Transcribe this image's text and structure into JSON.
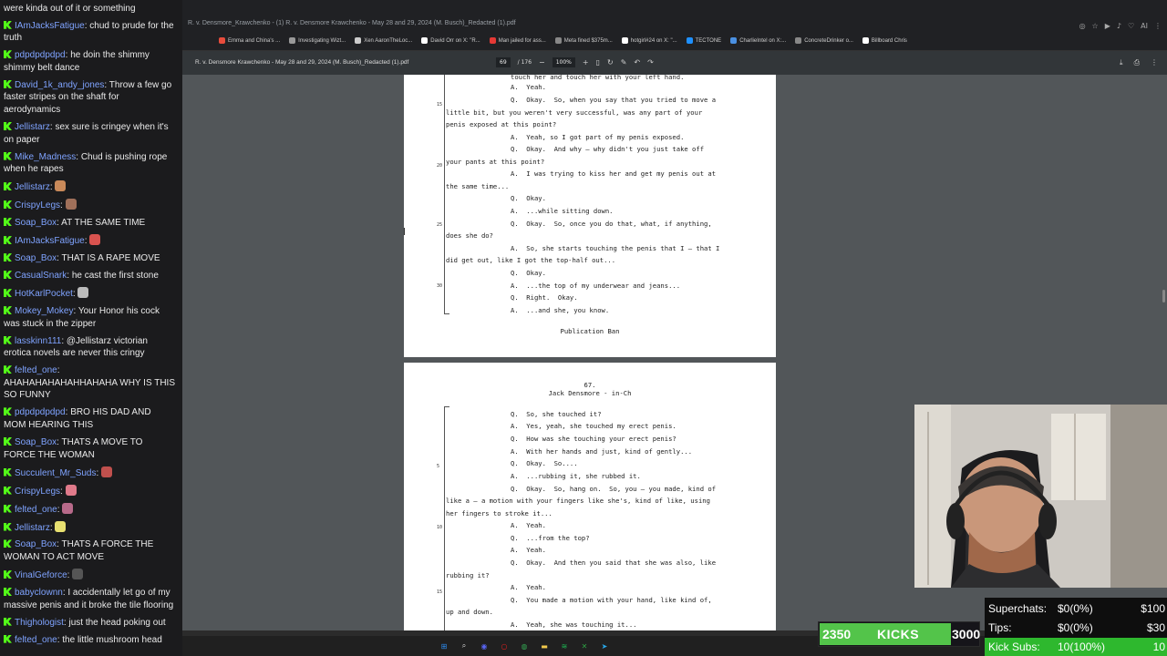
{
  "browser": {
    "url": "R. v. Densmore_Krawchenko - (1) R. v. Densmore Krawchenko - May 28 and 29, 2024 (M. Busch)_Redacted (1).pdf",
    "bookmarks": [
      "Emma and China's ...",
      "Investigating Wizt...",
      "Xen AaronTheLoc...",
      "David Orr on X: \"R...",
      "Man jailed for ass...",
      "Meta fined $375m...",
      "hotgirl#24 on X: \"...",
      "TECTONE",
      "CharlieIntel on X:...",
      "ConcreteDrinker o...",
      "Billboard Chris"
    ],
    "bookmark_colors": [
      "#e74c3c",
      "#999999",
      "#cccccc",
      "#ffffff",
      "#e53935",
      "#888888",
      "#ffffff",
      "#1e90ff",
      "#4a90e2",
      "#888888",
      "#ffffff"
    ]
  },
  "pdf_toolbar": {
    "title": "R. v. Densmore Krawchenko - May 28 and 29, 2024 (M. Busch)_Redacted (1).pdf",
    "page_current": "69",
    "page_total": "/ 176",
    "zoom": "100%"
  },
  "page1": {
    "lines": [
      "touch her and touch her with your left hand.",
      "A.  Yeah.",
      "Q.  Okay.  So, when you say that you tried to move a",
      "little bit, but you weren't very successful, was any part of your",
      "penis exposed at this point?",
      "A.  Yeah, so I got part of my penis exposed.",
      "Q.  Okay.  And why — why didn't you just take off",
      "your pants at this point?",
      "A.  I was trying to kiss her and get my penis out at",
      "the same time...",
      "Q.  Okay.",
      "A.  ...while sitting down.",
      "Q.  Okay.  So, once you do that, what, if anything,",
      "does she do?",
      "A.  So, she starts touching the penis that I — that I",
      "did get out, like I got the top-half out...",
      "Q.  Okay.",
      "A.  ...the top of my underwear and jeans...",
      "Q.  Right.  Okay.",
      "A.  ...and she, you know."
    ],
    "line_numbers": [
      "15",
      "20",
      "25",
      "30"
    ],
    "footer": "Publication Ban"
  },
  "page2": {
    "page_number": "67.",
    "heading": "Jack Densmore - in-Ch",
    "lines": [
      "Q.  So, she touched it?",
      "A.  Yes, yeah, she touched my erect penis.",
      "Q.  How was she touching your erect penis?",
      "A.  With her hands and just, kind of gently...",
      "Q.  Okay.  So....",
      "A.  ...rubbing it, she rubbed it.",
      "Q.  Okay.  So, hang on.  So, you — you made, kind of",
      "like a — a motion with your fingers like she's, kind of like, using",
      "her fingers to stroke it...",
      "A.  Yeah.",
      "Q.  ...from the top?",
      "A.  Yeah.",
      "Q.  Okay.  And then you said that she was also, like",
      "rubbing it?",
      "A.  Yeah.",
      "Q.  You made a motion with your hand, like kind of,",
      "up and down.",
      "A.  Yeah, she was touching it..."
    ],
    "line_numbers": [
      "5",
      "10",
      "15"
    ]
  },
  "chat": [
    {
      "user": "",
      "text": "said that they were both doing tent and were kinda out of it or something"
    },
    {
      "user": "IAmJacksFatigue",
      "text": "chud to prude for the truth"
    },
    {
      "user": "pdpdpdpdpd",
      "text": "he doin the shimmy shimmy belt dance"
    },
    {
      "user": "David_1k_andy_jones",
      "text": "Throw a few go faster stripes on the shaft for aerodynamics"
    },
    {
      "user": "Jellistarz",
      "text": "sex sure is cringey when it's on paper"
    },
    {
      "user": "Mike_Madness",
      "text": "Chud is pushing rope when he rapes"
    },
    {
      "user": "Jellistarz",
      "text": "",
      "emote": "#c98a5a"
    },
    {
      "user": "CrispyLegs",
      "text": "",
      "emote": "#a0705a"
    },
    {
      "user": "Soap_Box",
      "text": "AT THE SAME TIME"
    },
    {
      "user": "IAmJacksFatigue",
      "text": "",
      "emote": "#d9534f"
    },
    {
      "user": "Soap_Box",
      "text": "THAT IS A RAPE MOVE"
    },
    {
      "user": "CasualSnark",
      "text": "he cast the first stone"
    },
    {
      "user": "HotKarlPocket",
      "text": "",
      "emote": "#bbbbbb"
    },
    {
      "user": "Mokey_Mokey",
      "text": "Your Honor his cock was stuck in the zipper"
    },
    {
      "user": "lasskinn111",
      "text": "@Jellistarz victorian erotica novels are never this cringy"
    },
    {
      "user": "felted_one",
      "text": "AHAHAHAHAHAHHAHAHA WHY IS THIS SO FUNNY"
    },
    {
      "user": "pdpdpdpdpd",
      "text": "BRO HIS DAD AND MOM HEARING THIS"
    },
    {
      "user": "Soap_Box",
      "text": "THATS A MOVE TO FORCE THE WOMAN"
    },
    {
      "user": "Succulent_Mr_Suds",
      "text": "",
      "emote": "#c0504d"
    },
    {
      "user": "CrispyLegs",
      "text": "",
      "emote": "#e07a8a"
    },
    {
      "user": "felted_one",
      "text": "",
      "emote": "#b86a8a"
    },
    {
      "user": "Jellistarz",
      "text": "",
      "emote": "#e8e070"
    },
    {
      "user": "Soap_Box",
      "text": "THATS A FORCE THE WOMAN TO ACT MOVE"
    },
    {
      "user": "VinalGeforce",
      "text": "",
      "emote": "#555555"
    },
    {
      "user": "babyclownn",
      "text": "I accidentally let go of my massive penis and it broke the tile flooring"
    },
    {
      "user": "Thighologist",
      "text": "just the head poking out"
    },
    {
      "user": "felted_one",
      "text": "the little mushroom head"
    }
  ],
  "kicks": {
    "current": "2350",
    "label": "KICKS",
    "goal": "3000",
    "progress": 0.78
  },
  "goals": [
    {
      "label": "Superchats:",
      "value": "$0(0%)",
      "goal": "$100"
    },
    {
      "label": "Tips:",
      "value": "$0(0%)",
      "goal": "$30"
    },
    {
      "label": "Kick Subs:",
      "value": "10(100%)",
      "goal": "10"
    }
  ],
  "taskbar": {
    "icons": [
      "windows-icon",
      "search-icon",
      "discord-icon",
      "opera-icon",
      "chrome-icon",
      "folder-icon",
      "spotify-icon",
      "xbox-icon",
      "telegram-icon"
    ],
    "colors": [
      "#2d8cf0",
      "#dddddd",
      "#5865f2",
      "#e02020",
      "#34a853",
      "#f2c94c",
      "#1db954",
      "#2ea043",
      "#29a9eb"
    ]
  }
}
